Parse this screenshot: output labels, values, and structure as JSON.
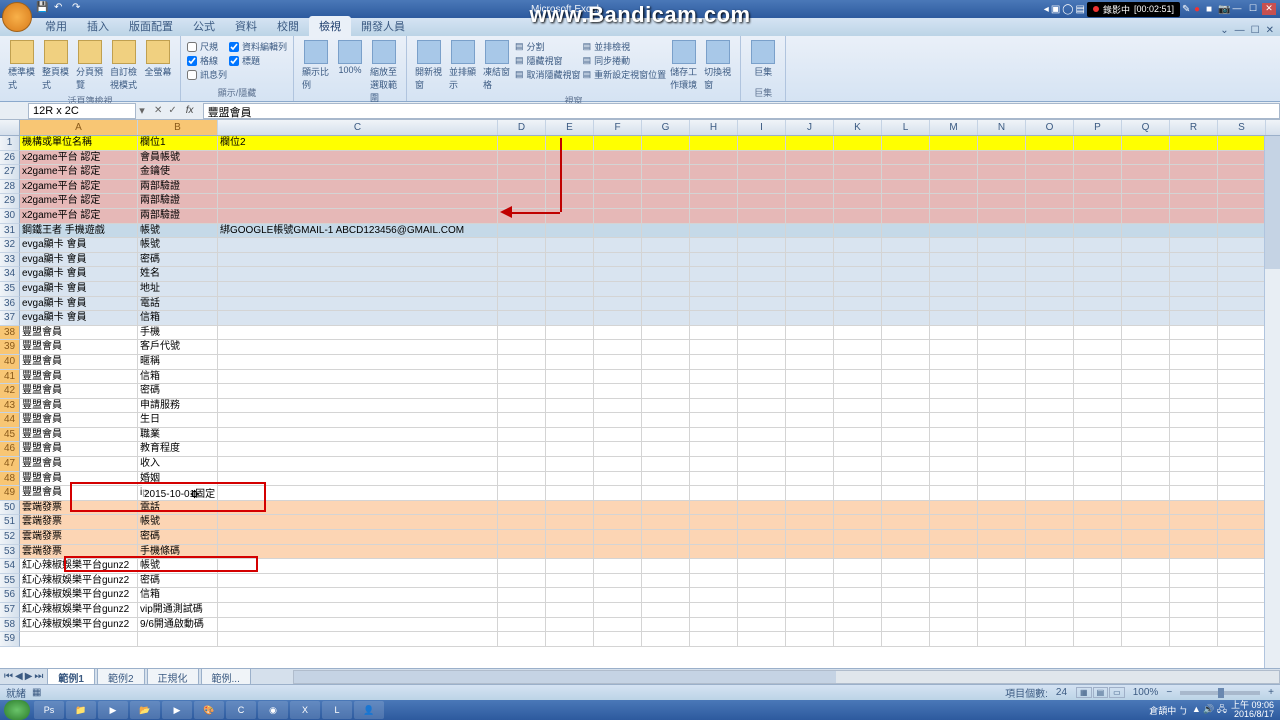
{
  "watermark": "www.Bandicam.com",
  "recording": {
    "label": "錄影中",
    "time": "[00:02:51]"
  },
  "title_app": "Microsoft Excel",
  "tabs": [
    "常用",
    "插入",
    "版面配置",
    "公式",
    "資料",
    "校閱",
    "檢視",
    "開發人員"
  ],
  "active_tab": "檢視",
  "ribbon": {
    "group1": {
      "label": "活頁簿檢視",
      "btns": [
        "標準模式",
        "整頁模式",
        "分頁預覽",
        "自訂檢視模式",
        "全螢幕"
      ]
    },
    "group2": {
      "label": "顯示/隱藏",
      "chk": [
        "尺規",
        "資料編輯列",
        "格線",
        "標題",
        "訊息列"
      ]
    },
    "group3": {
      "label": "顯示比例",
      "btns": [
        "顯示比例",
        "100%",
        "縮放至選取範圍"
      ]
    },
    "group4": {
      "label": "視窗",
      "btns": [
        "開新視窗",
        "並排顯示",
        "凍結窗格"
      ],
      "side": [
        "分割",
        "隱藏視窗",
        "取消隱藏視窗",
        "並排檢視",
        "同步捲動",
        "重新設定視窗位置"
      ],
      "btns2": [
        "儲存工作環境",
        "切換視窗"
      ]
    },
    "group5": {
      "label": "巨集",
      "btns": [
        "巨集"
      ]
    }
  },
  "name_box": "12R x 2C",
  "formula": "豐盟會員",
  "columns": [
    "A",
    "B",
    "C",
    "D",
    "E",
    "F",
    "G",
    "H",
    "I",
    "J",
    "K",
    "L",
    "M",
    "N",
    "O",
    "P",
    "Q",
    "R",
    "S"
  ],
  "row_start": 1,
  "row_numbers": [
    1,
    26,
    27,
    28,
    29,
    30,
    31,
    32,
    33,
    34,
    35,
    36,
    37,
    38,
    39,
    40,
    41,
    42,
    43,
    44,
    45,
    46,
    47,
    48,
    49,
    50,
    51,
    52,
    53,
    54,
    55,
    56,
    57,
    58,
    59
  ],
  "rows": [
    {
      "n": 1,
      "cls": "hdr-row",
      "A": "機構或單位名稱",
      "B": "欄位1",
      "C": "欄位2"
    },
    {
      "n": 26,
      "cls": "pink",
      "A": "x2game平台 認定",
      "B": "會員帳號",
      "C": ""
    },
    {
      "n": 27,
      "cls": "pink",
      "A": "x2game平台 認定",
      "B": "金鑰使",
      "C": ""
    },
    {
      "n": 28,
      "cls": "pink",
      "A": "x2game平台 認定",
      "B": "兩部驗證",
      "C": ""
    },
    {
      "n": 29,
      "cls": "pink",
      "A": "x2game平台 認定",
      "B": "兩部驗證",
      "C": ""
    },
    {
      "n": 30,
      "cls": "pink",
      "A": "x2game平台 認定",
      "B": "兩部驗證",
      "C": ""
    },
    {
      "n": 31,
      "cls": "bluegrey",
      "A": "鋼鐵王者 手機遊戲",
      "B": "帳號",
      "C": "綁GOOGLE帳號GMAIL-1  ABCD123456@GMAIL.COM"
    },
    {
      "n": 32,
      "cls": "lightblue",
      "A": "evga顯卡 會員",
      "B": "帳號",
      "C": ""
    },
    {
      "n": 33,
      "cls": "lightblue",
      "A": "evga顯卡 會員",
      "B": "密碼",
      "C": ""
    },
    {
      "n": 34,
      "cls": "lightblue",
      "A": "evga顯卡 會員",
      "B": "姓名",
      "C": ""
    },
    {
      "n": 35,
      "cls": "lightblue",
      "A": "evga顯卡 會員",
      "B": "地址",
      "C": ""
    },
    {
      "n": 36,
      "cls": "lightblue",
      "A": "evga顯卡 會員",
      "B": "電話",
      "C": ""
    },
    {
      "n": 37,
      "cls": "lightblue",
      "A": "evga顯卡 會員",
      "B": "信箱",
      "C": ""
    },
    {
      "n": 38,
      "cls": "plain",
      "A": "豐盟會員",
      "B": "手機",
      "C": ""
    },
    {
      "n": 39,
      "cls": "plain",
      "A": "豐盟會員",
      "B": "客戶代號",
      "C": ""
    },
    {
      "n": 40,
      "cls": "plain",
      "A": "豐盟會員",
      "B": "暱稱",
      "C": ""
    },
    {
      "n": 41,
      "cls": "plain",
      "A": "豐盟會員",
      "B": "信箱",
      "C": ""
    },
    {
      "n": 42,
      "cls": "plain",
      "A": "豐盟會員",
      "B": "密碼",
      "C": ""
    },
    {
      "n": 43,
      "cls": "plain",
      "A": "豐盟會員",
      "B": "申請服務",
      "C": ""
    },
    {
      "n": 44,
      "cls": "plain",
      "A": "豐盟會員",
      "B": "生日",
      "C": ""
    },
    {
      "n": 45,
      "cls": "plain",
      "A": "豐盟會員",
      "B": "職業",
      "C": ""
    },
    {
      "n": 46,
      "cls": "plain",
      "A": "豐盟會員",
      "B": "教育程度",
      "C": ""
    },
    {
      "n": 47,
      "cls": "plain",
      "A": "豐盟會員",
      "B": "收入",
      "C": ""
    },
    {
      "n": 48,
      "cls": "plain",
      "A": "豐盟會員",
      "B": "婚姻",
      "C": ""
    },
    {
      "n": 49,
      "cls": "plain",
      "A": "豐盟會員",
      "B": "ip",
      "C": ""
    },
    {
      "n": 50,
      "cls": "orange",
      "A": "雲端發票",
      "B": "電話",
      "C": ""
    },
    {
      "n": 51,
      "cls": "orange",
      "A": "雲端發票",
      "B": "帳號",
      "C": ""
    },
    {
      "n": 52,
      "cls": "orange",
      "A": "雲端發票",
      "B": "密碼",
      "C": ""
    },
    {
      "n": 53,
      "cls": "orange",
      "A": "雲端發票",
      "B": "手機條碼",
      "C": ""
    },
    {
      "n": 54,
      "cls": "plain",
      "A": "紅心辣椒娛樂平台gunz2",
      "B": "帳號",
      "C": ""
    },
    {
      "n": 55,
      "cls": "plain",
      "A": "紅心辣椒娛樂平台gunz2",
      "B": "密碼",
      "C": ""
    },
    {
      "n": 56,
      "cls": "plain",
      "A": "紅心辣椒娛樂平台gunz2",
      "B": "信箱",
      "C": ""
    },
    {
      "n": 57,
      "cls": "plain",
      "A": "紅心辣椒娛樂平台gunz2",
      "B": "vip開通測試碼",
      "C": ""
    },
    {
      "n": 58,
      "cls": "plain",
      "A": "紅心辣椒娛樂平台gunz2",
      "B": "9/6開通啟動碼",
      "C": ""
    },
    {
      "n": 59,
      "cls": "plain",
      "A": "",
      "B": "",
      "C": ""
    }
  ],
  "tooltip": "2015-10-01固定",
  "selection": {
    "rows_from": 38,
    "rows_to": 49,
    "cols": [
      "A",
      "B"
    ]
  },
  "sheet_tabs": [
    "範例1",
    "範例2",
    "正規化",
    "範例..."
  ],
  "active_sheet": "範例1",
  "status_left": "就緒",
  "status_right": {
    "count_label": "項目個數:",
    "count": 24,
    "zoom": "100%"
  },
  "tray": {
    "time": "上午 09:06",
    "date": "2016/8/17",
    "ime": "倉頡中 ㄅ"
  },
  "taskbar_apps": [
    "Ps",
    "📁",
    "▶",
    "📂",
    "▶",
    "🎨",
    "C",
    "◉",
    "X",
    "L",
    "👤"
  ]
}
